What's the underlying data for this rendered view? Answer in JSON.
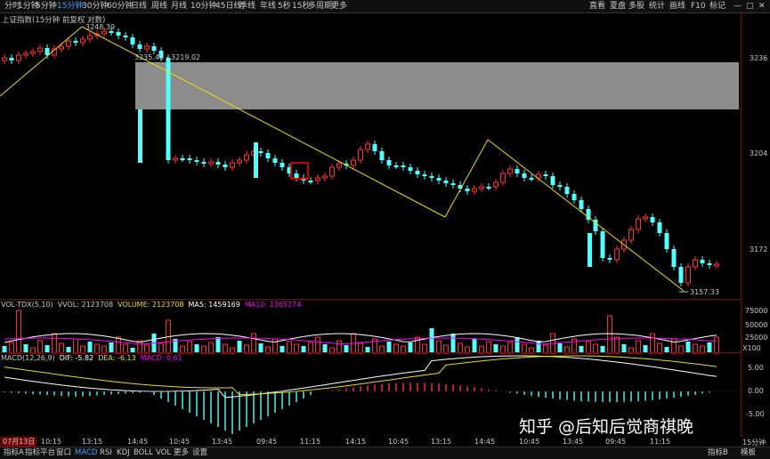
{
  "toolbar": {
    "periods": [
      "分时",
      "1分钟",
      "5分钟",
      "15分钟",
      "30分钟",
      "60分钟",
      "日线",
      "周线",
      "月线",
      "10分钟",
      "45日线",
      "季线",
      "年线",
      "5秒",
      "15秒",
      "多周期",
      "更多"
    ],
    "active_period": "15分钟",
    "right_tools": [
      "直看",
      "夏盘",
      "多股",
      "统计",
      "画线",
      "F10",
      "标记"
    ]
  },
  "chart_title": "上证指数(15分钟 前复权 对数)",
  "annotations": {
    "high_label": "3248.39",
    "range_label": "3235.46 - 3219.02",
    "low_label": "3157.33"
  },
  "price_axis": {
    "ticks": [
      "3236",
      "3204",
      "3172"
    ]
  },
  "volume_header": {
    "name": "VOL-TDX(5,10)",
    "vvol": "VVOL: 2123708",
    "volume": "VOLUME: 2123708",
    "ma5": "MA5: 1459169",
    "ma10": "MA10: 1365274"
  },
  "volume_axis": {
    "ticks": [
      "75000",
      "50000",
      "25000"
    ],
    "unit": "X100"
  },
  "macd_header": {
    "name": "MACD(12,26,9)",
    "dif": "DIF: -5.82",
    "dea": "DEA: -6.13",
    "macd": "MACD: 0.61"
  },
  "macd_axis": {
    "ticks": [
      "5.00",
      "0.00",
      "-5.00"
    ]
  },
  "time_axis": {
    "date": "07月13日",
    "labels": [
      "10:15",
      "13:15",
      "14:45",
      "10:45",
      "13:45",
      "09:45",
      "11:15",
      "14:15",
      "10:45",
      "13:15",
      "14:45",
      "10:45",
      "13:45",
      "09:45",
      "11:15"
    ],
    "period": "15分钟"
  },
  "bottom_tabs": [
    "指标A",
    "指标平台",
    "窗口",
    "MACD",
    "RSI",
    "KDJ",
    "BOLL",
    "VOL",
    "更多",
    "设置"
  ],
  "bottom_right": [
    "指标B",
    "模板"
  ],
  "watermark": "知乎 @后知后觉商祺晚",
  "colors": {
    "up": "#ff3232",
    "down": "#54ffff",
    "line": "#e8e000",
    "ma_white": "#ffffff",
    "ma_magenta": "#ff00ff",
    "zone": "#8c8c8c",
    "box": "#ff0000"
  }
}
